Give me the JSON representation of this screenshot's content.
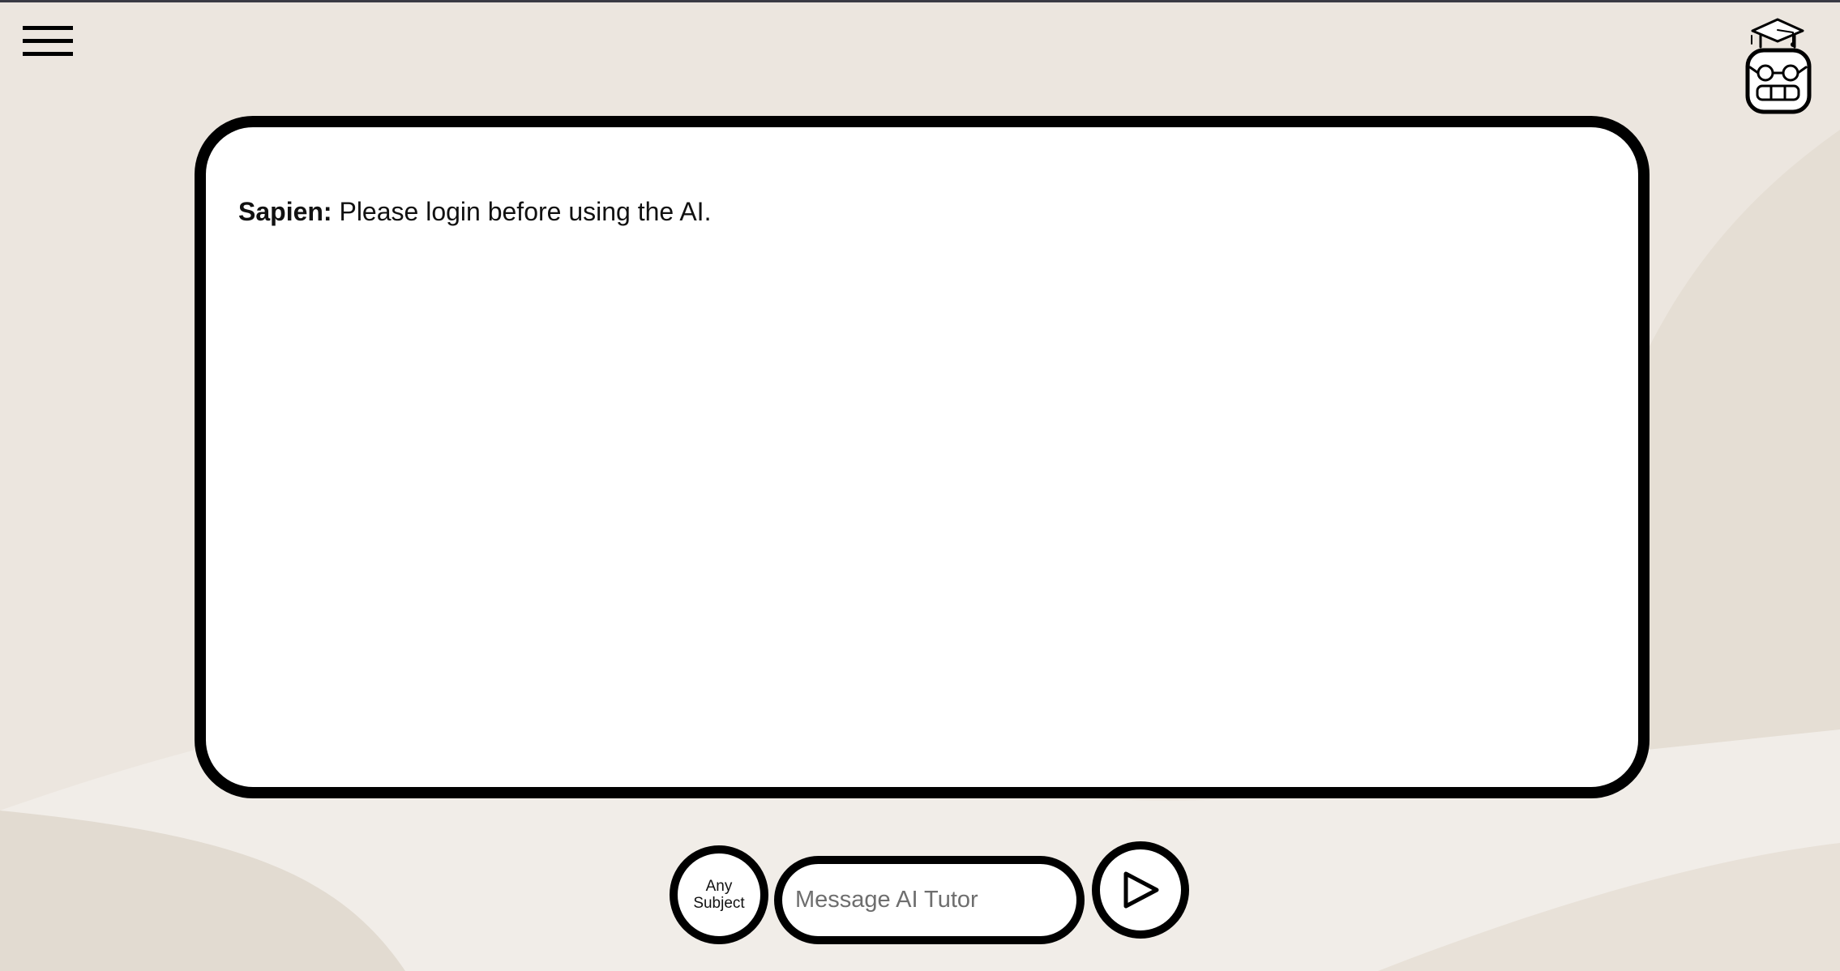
{
  "app": {
    "background_color": "#ece6df",
    "accent_color": "#000000"
  },
  "header": {
    "menu_icon": "hamburger-menu-icon",
    "logo_icon": "robot-graduation-cap-icon"
  },
  "chat": {
    "messages": [
      {
        "speaker": "Sapien:",
        "text": " Please login before using the AI."
      }
    ]
  },
  "composer": {
    "subject_line1": "Any",
    "subject_line2": "Subject",
    "input_placeholder": "Message AI Tutor",
    "input_value": "",
    "send_icon": "play-triangle-icon"
  }
}
